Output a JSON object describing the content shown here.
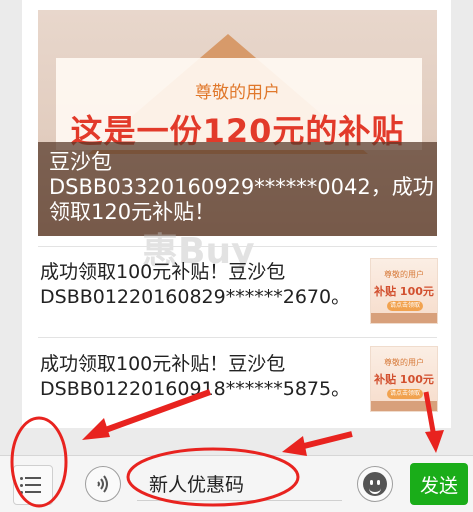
{
  "hero": {
    "greeting": "尊敬的用户",
    "headline": "这是一份120元的补贴",
    "caption_lines": [
      "豆沙包",
      "DSBB03320160929******0042，成功",
      "领取120元补贴！"
    ]
  },
  "watermark": "惠Buy",
  "messages": [
    {
      "lines": [
        "成功领取100元补贴！豆沙包",
        "DSBB01220160829******2670。"
      ],
      "thumb": {
        "title": "尊敬的用户",
        "label": "补贴 100元",
        "button": "请点击领取"
      }
    },
    {
      "lines": [
        "成功领取100元补贴！豆沙包",
        "DSBB01220160918******5875。"
      ],
      "thumb": {
        "title": "尊敬的用户",
        "label": "补贴 100元",
        "button": "请点击领取"
      }
    }
  ],
  "toolbar": {
    "input_value": "新人优惠码",
    "send_label": "发送",
    "voice_icon": "voice-icon",
    "menu_icon": "menu-list-icon",
    "emoji_icon": "emoji-icon"
  },
  "colors": {
    "send_green": "#1aad19",
    "annotation_red": "#e8231f"
  }
}
